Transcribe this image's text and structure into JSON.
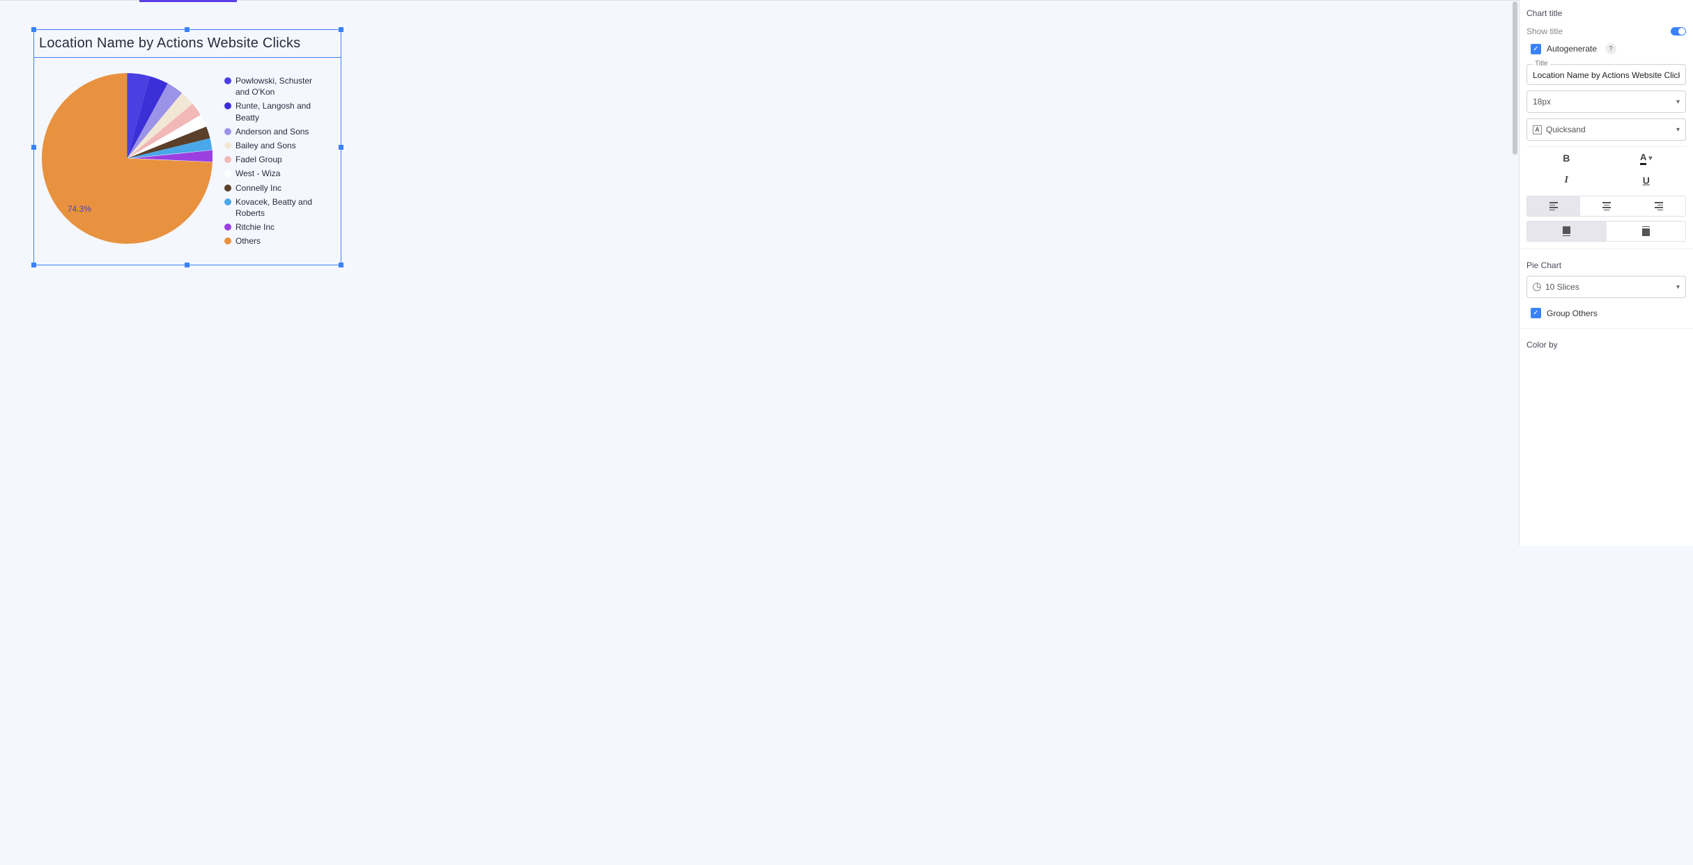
{
  "chart": {
    "title": "Location Name by Actions Website Clicks",
    "slice_label": "74.3%"
  },
  "legend": [
    {
      "label": "Powlowski, Schuster and O'Kon",
      "color": "#4a3fe0"
    },
    {
      "label": "Runte, Langosh and Beatty",
      "color": "#3b2fd8"
    },
    {
      "label": "Anderson and Sons",
      "color": "#9b93e8"
    },
    {
      "label": "Bailey and Sons",
      "color": "#f2e7d5"
    },
    {
      "label": "Fadel Group",
      "color": "#f2b8b8"
    },
    {
      "label": "West - Wiza",
      "color": "#ffffff"
    },
    {
      "label": "Connelly Inc",
      "color": "#5a3f2a"
    },
    {
      "label": "Kovacek, Beatty and Roberts",
      "color": "#4aa8e8"
    },
    {
      "label": "Ritchie Inc",
      "color": "#9b3fe0"
    },
    {
      "label": "Others",
      "color": "#e8923f"
    }
  ],
  "chart_data": {
    "type": "pie",
    "title": "Location Name by Actions Website Clicks",
    "series": [
      {
        "name": "Powlowski, Schuster and O'Kon",
        "value": 4.3,
        "color": "#4a3fe0"
      },
      {
        "name": "Runte, Langosh and Beatty",
        "value": 3.6,
        "color": "#3b2fd8"
      },
      {
        "name": "Anderson and Sons",
        "value": 3.2,
        "color": "#9b93e8"
      },
      {
        "name": "Bailey and Sons",
        "value": 2.8,
        "color": "#f2e7d5"
      },
      {
        "name": "Fadel Group",
        "value": 2.6,
        "color": "#f2b8b8"
      },
      {
        "name": "West - Wiza",
        "value": 2.4,
        "color": "#ffffff"
      },
      {
        "name": "Connelly Inc",
        "value": 2.3,
        "color": "#5a3f2a"
      },
      {
        "name": "Kovacek, Beatty and Roberts",
        "value": 2.2,
        "color": "#4aa8e8"
      },
      {
        "name": "Ritchie Inc",
        "value": 2.3,
        "color": "#9b3fe0"
      },
      {
        "name": "Others",
        "value": 74.3,
        "color": "#e8923f"
      }
    ]
  },
  "sidebar": {
    "chart_title_section": "Chart title",
    "show_title_label": "Show title",
    "autogenerate_label": "Autogenerate",
    "help_icon": "?",
    "title_field_label": "Title",
    "title_field_value": "Location Name by Actions Website Clicks",
    "font_size_value": "18px",
    "font_family_value": "Quicksand",
    "pie_chart_section": "Pie Chart",
    "slices_value": "10 Slices",
    "group_others_label": "Group Others",
    "color_by_section": "Color by"
  }
}
